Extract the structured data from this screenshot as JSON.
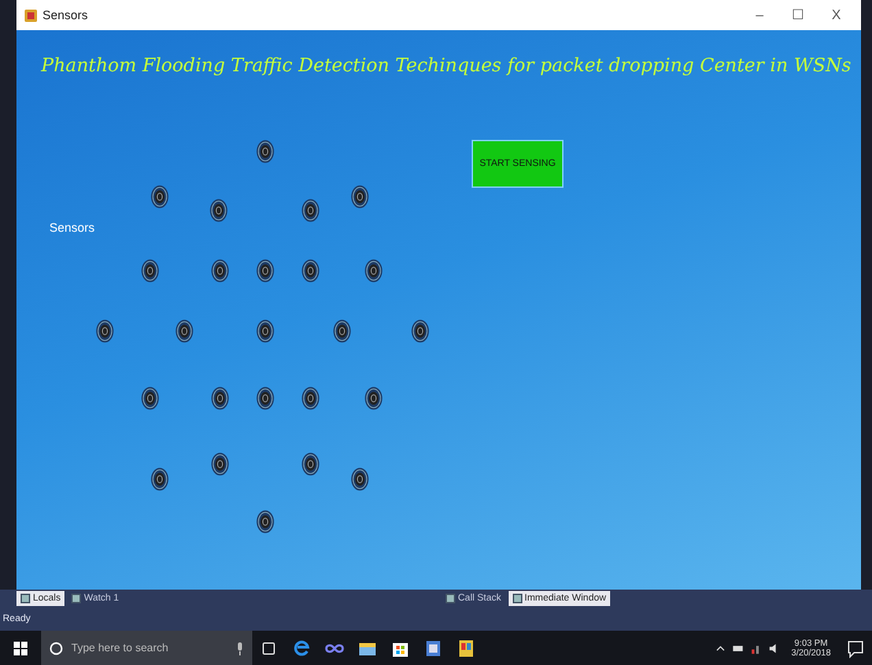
{
  "window": {
    "title": "Sensors",
    "controls": [
      "–",
      "☐",
      "X"
    ]
  },
  "form": {
    "heading": "Phanthom Flooding Traffic Detection Techinques for packet dropping Center in WSNs",
    "sensors_label": "Sensors",
    "button": "START SENSING"
  },
  "debug_tabs_left": [
    {
      "label": "Locals",
      "selected": true
    },
    {
      "label": "Watch 1",
      "selected": false
    }
  ],
  "debug_tabs_right": [
    {
      "label": "Call Stack",
      "selected": false
    },
    {
      "label": "Immediate Window",
      "selected": true
    }
  ],
  "status_bar": "Ready",
  "taskbar": {
    "search_placeholder": "Type here to search",
    "time": "9:03 PM",
    "date": "3/20/2018"
  }
}
